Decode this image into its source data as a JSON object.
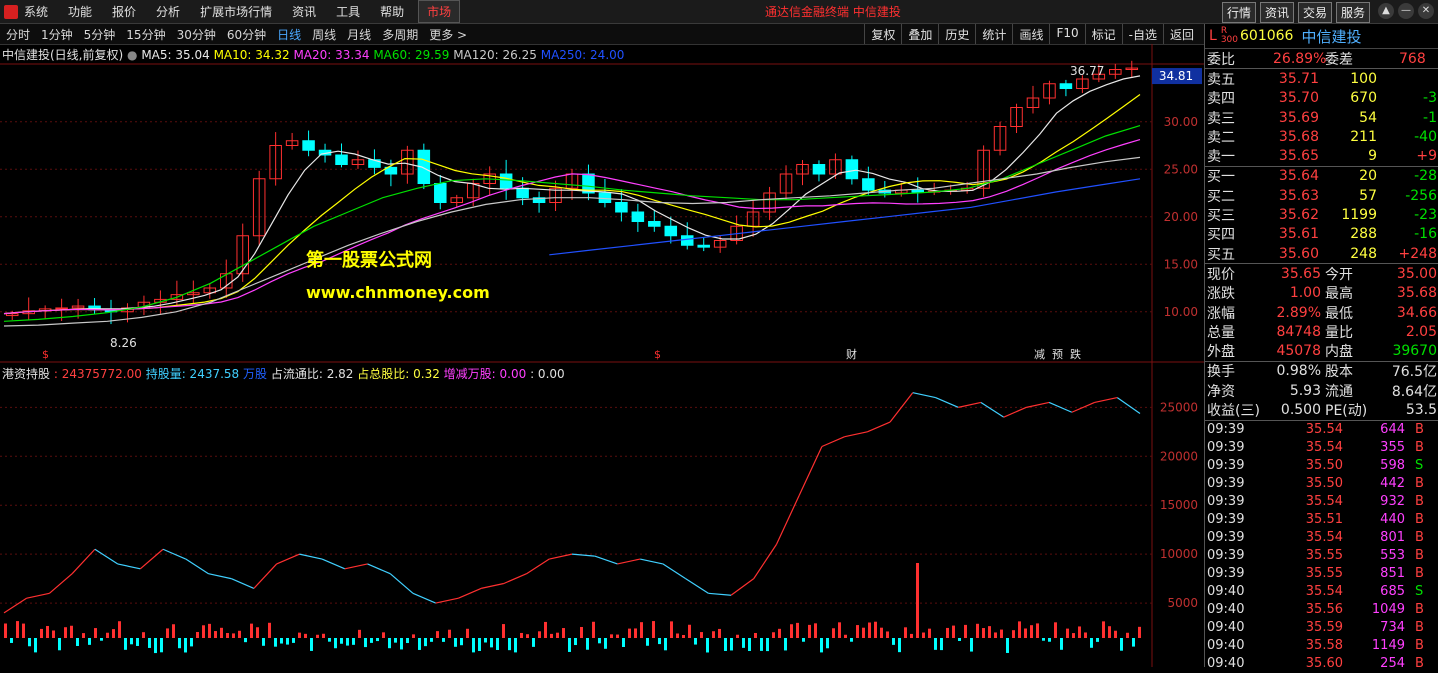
{
  "menu": {
    "items": [
      "系统",
      "功能",
      "报价",
      "分析",
      "扩展市场行情",
      "资讯",
      "工具",
      "帮助"
    ],
    "market": "市场",
    "window_title": "通达信金融终端  中信建投"
  },
  "topbuttons": [
    "行情",
    "资讯",
    "交易",
    "服务"
  ],
  "window_controls": [
    "▲",
    "—",
    "✕"
  ],
  "periods": {
    "items": [
      "分时",
      "1分钟",
      "5分钟",
      "15分钟",
      "30分钟",
      "60分钟",
      "日线",
      "周线",
      "月线",
      "多周期",
      "更多 >"
    ],
    "active_index": 6
  },
  "right_tools": [
    "复权",
    "叠加",
    "历史",
    "统计",
    "画线",
    "F10",
    "标记",
    "-自选",
    "返回"
  ],
  "main_legend": {
    "title": "中信建投(日线,前复权)",
    "items": [
      {
        "label": "MA5: 35.04",
        "color": "#e8e8e8"
      },
      {
        "label": "MA10: 34.32",
        "color": "#ffff00"
      },
      {
        "label": "MA20: 33.34",
        "color": "#ff40ff"
      },
      {
        "label": "MA60: 29.59",
        "color": "#00e000"
      },
      {
        "label": "MA120: 26.25",
        "color": "#c8c8c8"
      },
      {
        "label": "MA250: 24.00",
        "color": "#2050ff"
      }
    ]
  },
  "sub_legend": {
    "items": [
      {
        "label": "港资持股",
        "color": "#e0e0e0"
      },
      {
        "label": ": 24375772.00",
        "color": "#ff4040"
      },
      {
        "label": "持股量: 2437.58",
        "color": "#40d0ff"
      },
      {
        "label": "万股",
        "color": "#2060ff"
      },
      {
        "label": "占流通比: 2.82",
        "color": "#e0e0e0"
      },
      {
        "label": "占总股比: 0.32",
        "color": "#ffff40"
      },
      {
        "label": "增减万股: 0.00",
        "color": "#ff40ff"
      },
      {
        "label": ": 0.00",
        "color": "#e0e0e0"
      }
    ]
  },
  "price_axis": {
    "ticks": [
      "30.00",
      "25.00",
      "20.00",
      "15.00",
      "10.00"
    ],
    "values": [
      30,
      25,
      20,
      15,
      10
    ],
    "current_tag": "34.81",
    "current_value": 34.81,
    "range": [
      6.5,
      36.5
    ]
  },
  "holding_axis": {
    "ticks": [
      "25000",
      "20000",
      "15000",
      "10000",
      "5000"
    ],
    "values": [
      25000,
      20000,
      15000,
      10000,
      5000
    ],
    "range": [
      0,
      28000
    ]
  },
  "annotations": {
    "high": "36.77",
    "low": "8.26",
    "watermark1": "第一股票公式网",
    "watermark2": "www.chnmoney.com",
    "markers": [
      {
        "t": "$",
        "c": "#ff3030"
      },
      {
        "t": "$",
        "c": "#ff3030"
      },
      {
        "t": "财",
        "c": "#e0e0e0"
      },
      {
        "t": "减",
        "c": "#e0e0e0"
      },
      {
        "t": "预",
        "c": "#e0e0e0"
      },
      {
        "t": "跌",
        "c": "#e0e0e0"
      }
    ]
  },
  "colors": {
    "up": "#ff3030",
    "down": "#00ffff",
    "holding_up": "#ff3030",
    "holding_down": "#40d0ff"
  },
  "chart_data": {
    "type": "line",
    "title": "中信建投(日线,前复权)",
    "close_series": [
      9.8,
      10.1,
      10.3,
      10.4,
      10.6,
      10.2,
      10.0,
      10.4,
      11.0,
      11.3,
      11.8,
      12.0,
      12.5,
      14.0,
      18.0,
      24.0,
      27.5,
      28.0,
      27.0,
      26.5,
      25.5,
      26.0,
      25.2,
      24.5,
      27.0,
      23.5,
      21.5,
      22.0,
      23.5,
      24.5,
      23.0,
      22.0,
      21.5,
      23.0,
      24.5,
      22.5,
      21.5,
      20.5,
      19.5,
      19.0,
      18.0,
      17.0,
      16.8,
      17.5,
      19.0,
      20.5,
      22.5,
      24.5,
      25.5,
      24.5,
      26.0,
      24.0,
      22.8,
      22.5,
      22.8,
      22.6,
      22.7,
      22.8,
      23.0,
      27.0,
      29.5,
      31.5,
      32.5,
      34.0,
      33.5,
      34.5,
      35.0,
      35.5,
      35.65
    ],
    "ma_series": [
      {
        "name": "MA60",
        "values": [
          9.0,
          9.2,
          9.5,
          9.9,
          10.5,
          11.5,
          13.0,
          15.0,
          17.0,
          19.0,
          20.5,
          22.0,
          23.0,
          23.8,
          24.0,
          23.8,
          23.5,
          23.2,
          22.8,
          22.5,
          22.2,
          22.0,
          21.8,
          21.8,
          22.0,
          22.2,
          22.4,
          22.6,
          23.0,
          24.0,
          25.5,
          27.0,
          28.5,
          29.59
        ]
      },
      {
        "name": "MA120",
        "values": [
          8.5,
          8.6,
          8.8,
          9.0,
          9.4,
          10.0,
          11.0,
          12.5,
          14.0,
          15.5,
          17.0,
          18.3,
          19.5,
          20.5,
          21.3,
          21.8,
          22.0,
          22.0,
          21.8,
          21.5,
          21.4,
          21.5,
          21.8,
          22.0,
          22.2,
          22.5,
          22.8,
          23.0,
          23.5,
          24.0,
          24.5,
          25.2,
          25.8,
          26.25
        ]
      },
      {
        "name": "MA250",
        "values": [
          16.0,
          16.5,
          17.0,
          17.5,
          18.0,
          18.5,
          19.0,
          19.5,
          20.0,
          20.5,
          21.0,
          21.8,
          22.6,
          23.3,
          24.0
        ]
      }
    ],
    "holding_series": [
      4000,
      5500,
      6000,
      8000,
      10500,
      9000,
      8500,
      10500,
      9500,
      8000,
      7500,
      6500,
      9000,
      10000,
      9500,
      8500,
      9000,
      8000,
      6000,
      5000,
      5500,
      6500,
      7000,
      8000,
      9500,
      10000,
      9800,
      9000,
      9500,
      9000,
      7500,
      6000,
      5800,
      7500,
      11000,
      16000,
      21000,
      22000,
      22500,
      23500,
      26500,
      26000,
      25000,
      25500,
      24000,
      25000,
      25500,
      24500,
      25500,
      26000,
      24375
    ]
  },
  "quote": {
    "code": "601066",
    "name": "中信建投",
    "tag": "L",
    "r300": "R\n300",
    "weibi": {
      "label": "委比",
      "value": "26.89%",
      "label2": "委差",
      "value2": "768"
    },
    "asks": [
      [
        "卖五",
        "35.71",
        "100",
        ""
      ],
      [
        "卖四",
        "35.70",
        "670",
        "-3"
      ],
      [
        "卖三",
        "35.69",
        "54",
        "-1"
      ],
      [
        "卖二",
        "35.68",
        "211",
        "-40"
      ],
      [
        "卖一",
        "35.65",
        "9",
        "+9"
      ]
    ],
    "bids": [
      [
        "买一",
        "35.64",
        "20",
        "-28"
      ],
      [
        "买二",
        "35.63",
        "57",
        "-256"
      ],
      [
        "买三",
        "35.62",
        "1199",
        "-23"
      ],
      [
        "买四",
        "35.61",
        "288",
        "-16"
      ],
      [
        "买五",
        "35.60",
        "248",
        "+248"
      ]
    ],
    "stats": [
      [
        "现价",
        "35.65",
        "今开",
        "35.00"
      ],
      [
        "涨跌",
        "1.00",
        "最高",
        "35.68"
      ],
      [
        "涨幅",
        "2.89%",
        "最低",
        "34.66"
      ],
      [
        "总量",
        "84748",
        "量比",
        "2.05"
      ],
      [
        "外盘",
        "45078",
        "内盘",
        "39670"
      ]
    ],
    "stats2": [
      [
        "换手",
        "0.98%",
        "股本",
        "76.5亿"
      ],
      [
        "净资",
        "5.93",
        "流通",
        "8.64亿"
      ],
      [
        "收益(三)",
        "0.500",
        "PE(动)",
        "53.5"
      ]
    ],
    "ticks": [
      [
        "09:39",
        "35.54",
        "644",
        "B"
      ],
      [
        "09:39",
        "35.54",
        "355",
        "B"
      ],
      [
        "09:39",
        "35.50",
        "598",
        "S"
      ],
      [
        "09:39",
        "35.50",
        "442",
        "B"
      ],
      [
        "09:39",
        "35.54",
        "932",
        "B"
      ],
      [
        "09:39",
        "35.51",
        "440",
        "B"
      ],
      [
        "09:39",
        "35.54",
        "801",
        "B"
      ],
      [
        "09:39",
        "35.55",
        "553",
        "B"
      ],
      [
        "09:39",
        "35.55",
        "851",
        "B"
      ],
      [
        "09:40",
        "35.54",
        "685",
        "S"
      ],
      [
        "09:40",
        "35.56",
        "1049",
        "B"
      ],
      [
        "09:40",
        "35.59",
        "734",
        "B"
      ],
      [
        "09:40",
        "35.58",
        "1149",
        "B"
      ],
      [
        "09:40",
        "35.60",
        "254",
        "B"
      ]
    ]
  }
}
